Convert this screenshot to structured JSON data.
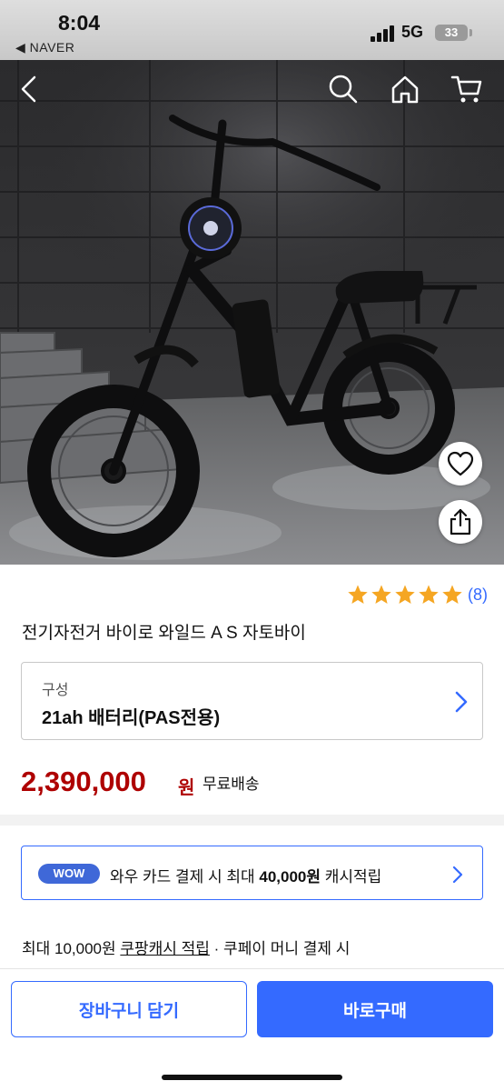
{
  "status_bar": {
    "time": "8:04",
    "back_app": "◀ NAVER",
    "network": "5G",
    "battery": "33"
  },
  "header": {
    "icons": [
      "back-icon",
      "search-icon",
      "home-icon",
      "cart-icon"
    ]
  },
  "product": {
    "image_alt": "black fat-tire electric bike on concrete stairs",
    "rating": 5,
    "review_count": "(8)",
    "title": "전기자전거 바이로 와일드 A S 자토바이",
    "option_label": "구성",
    "option_value": "21ah 배터리(PAS전용)",
    "price": "2,390,000",
    "price_unit": "원",
    "shipping": "무료배송"
  },
  "wow_banner": {
    "badge": "WOW",
    "text_before": "와우 카드 결제 시 최대 ",
    "amount": "40,000원",
    "text_after": " 캐시적립"
  },
  "cash_info": {
    "prefix": "최대 10,000원 ",
    "link": "쿠팡캐시 적립",
    "suffix": " · 쿠페이 머니 결제 시"
  },
  "bottom_bar": {
    "cart_button": "장바구니 담기",
    "buy_button": "바로구매"
  },
  "colors": {
    "accent": "#346aff",
    "price": "#ae0000",
    "star": "#f5a623"
  }
}
